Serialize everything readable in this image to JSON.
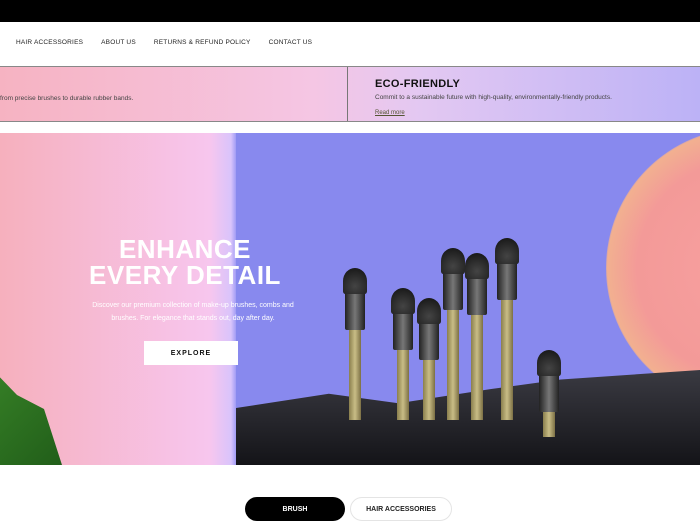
{
  "nav": {
    "items": [
      "HAIR ACCESSORIES",
      "ABOUT US",
      "RETURNS & REFUND POLICY",
      "CONTACT US"
    ]
  },
  "features": {
    "left_text": "from precise brushes to durable rubber bands.",
    "eco_title": "ECO-FRIENDLY",
    "eco_text": "Commit to a sustainable future with high-quality, environmentally-friendly products.",
    "read_more": "Read more"
  },
  "hero": {
    "title_line1": "ENHANCE",
    "title_line2": "EVERY DETAIL",
    "subtitle": "Discover our premium collection of make-up brushes, combs and brushes. For elegance that stands out, day after day.",
    "cta": "EXPLORE"
  },
  "category_tabs": [
    {
      "label": "BRUSH",
      "active": true
    },
    {
      "label": "HAIR ACCESSORIES",
      "active": false
    }
  ]
}
